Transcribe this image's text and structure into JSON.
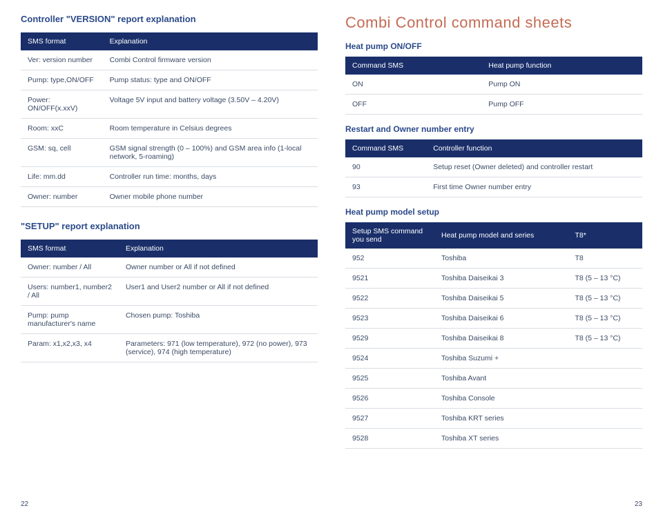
{
  "left": {
    "title1": "Controller \"VERSION\" report explanation",
    "versionTable": {
      "head": [
        "SMS format",
        "Explanation"
      ],
      "rows": [
        [
          "Ver: version number",
          "Combi Control firmware version"
        ],
        [
          "Pump: type,ON/OFF",
          "Pump status: type and ON/OFF"
        ],
        [
          "Power: ON/OFF(x.xxV)",
          "Voltage 5V input and battery voltage (3.50V – 4.20V)"
        ],
        [
          "Room: xxC",
          "Room temperature in Celsius degrees"
        ],
        [
          "GSM: sq, cell",
          "GSM signal strength (0 – 100%) and GSM area info (1-local network, 5-roaming)"
        ],
        [
          "Life: mm.dd",
          "Controller run time: months, days"
        ],
        [
          "Owner: number",
          "Owner mobile phone number"
        ]
      ]
    },
    "title2": "\"SETUP\" report explanation",
    "setupTable": {
      "head": [
        "SMS format",
        "Explanation"
      ],
      "rows": [
        [
          "Owner: number / All",
          "Owner number or All if not defined"
        ],
        [
          "Users: number1, number2 / All",
          "User1 and User2 number or All if not defined"
        ],
        [
          "Pump: pump manufacturer's name",
          "Chosen pump:\nToshiba"
        ],
        [
          "Param: x1,x2,x3, x4",
          "Parameters: 971 (low temperature), 972 (no power), 973 (service), 974 (high temperature)"
        ]
      ]
    },
    "pageNum": "22"
  },
  "right": {
    "bigTitle": "Combi Control command sheets",
    "sub1": "Heat pump ON/OFF",
    "onoffTable": {
      "head": [
        "Command SMS",
        "Heat pump function"
      ],
      "rows": [
        [
          "ON",
          "Pump ON"
        ],
        [
          "OFF",
          "Pump OFF"
        ]
      ]
    },
    "sub2": "Restart and Owner number entry",
    "restartTable": {
      "head": [
        "Command SMS",
        "Controller function"
      ],
      "rows": [
        [
          "90",
          "Setup reset (Owner deleted) and controller restart"
        ],
        [
          "93",
          "First time Owner number entry"
        ]
      ]
    },
    "sub3": "Heat pump model setup",
    "modelTable": {
      "head": [
        "Setup SMS command you send",
        "Heat pump model and series",
        "T8*"
      ],
      "rows": [
        [
          "952",
          "Toshiba",
          "T8"
        ],
        [
          "9521",
          "Toshiba Daiseikai 3",
          "T8 (5 – 13 °C)"
        ],
        [
          "9522",
          "Toshiba Daiseikai 5",
          "T8 (5 – 13 °C)"
        ],
        [
          "9523",
          "Toshiba Daiseikai 6",
          "T8 (5 – 13 °C)"
        ],
        [
          "9529",
          "Toshiba Daiseikai 8",
          "T8 (5 – 13 °C)"
        ],
        [
          "9524",
          "Toshiba Suzumi +",
          ""
        ],
        [
          "9525",
          "Toshiba Avant",
          ""
        ],
        [
          "9526",
          "Toshiba Console",
          ""
        ],
        [
          "9527",
          "Toshiba KRT series",
          ""
        ],
        [
          "9528",
          "Toshiba XT series",
          ""
        ]
      ]
    },
    "pageNum": "23"
  }
}
